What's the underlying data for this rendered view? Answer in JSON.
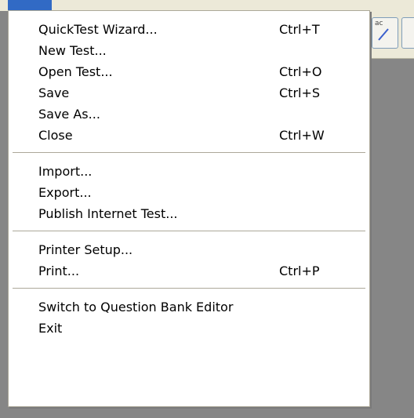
{
  "menu": {
    "items": [
      {
        "label": "QuickTest Wizard...",
        "shortcut": "Ctrl+T"
      },
      {
        "label": "New Test...",
        "shortcut": ""
      },
      {
        "label": "Open Test...",
        "shortcut": "Ctrl+O"
      },
      {
        "label": "Save",
        "shortcut": "Ctrl+S"
      },
      {
        "label": "Save As...",
        "shortcut": ""
      },
      {
        "label": "Close",
        "shortcut": "Ctrl+W"
      },
      {
        "label": "Import...",
        "shortcut": ""
      },
      {
        "label": "Export...",
        "shortcut": ""
      },
      {
        "label": "Publish Internet Test...",
        "shortcut": ""
      },
      {
        "label": "Printer Setup...",
        "shortcut": ""
      },
      {
        "label": "Print...",
        "shortcut": "Ctrl+P"
      },
      {
        "label": "Switch to Question Bank Editor",
        "shortcut": ""
      },
      {
        "label": "Exit",
        "shortcut": ""
      }
    ]
  },
  "toolbar": {
    "button1_text": "ac",
    "button1_icon": "pencil-slash-icon"
  },
  "colors": {
    "menu_highlight": "#316ac5",
    "menu_bg": "#ffffff",
    "app_bg": "#868686",
    "chrome_bg": "#ece9d8"
  }
}
